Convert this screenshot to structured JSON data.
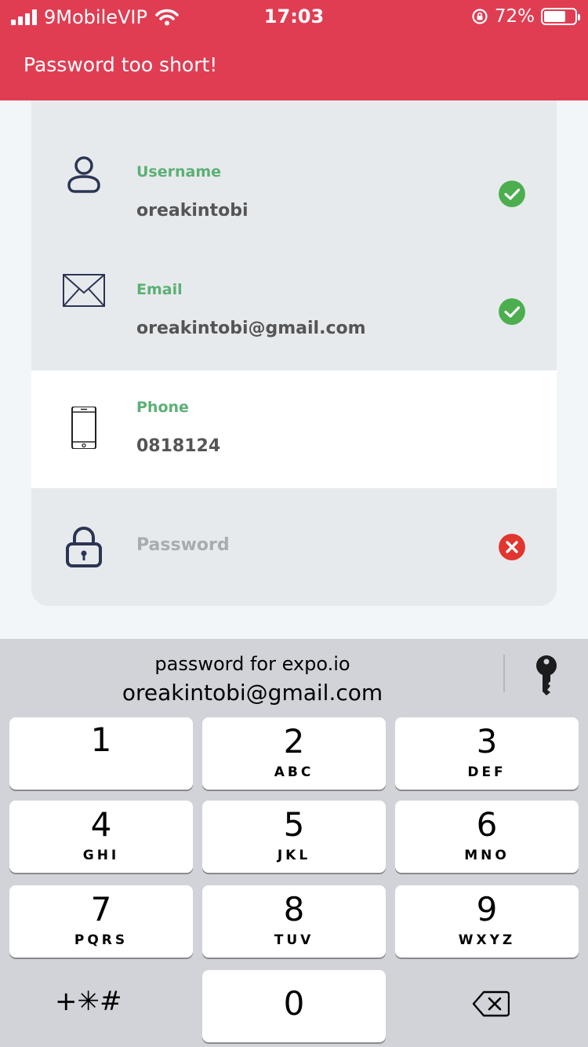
{
  "status_bar": {
    "carrier": "9MobileVIP",
    "time": "17:03",
    "battery_percent_text": "72%",
    "battery_level": 0.72
  },
  "toast": {
    "message": "Password too short!",
    "color": "#e03d53"
  },
  "form": {
    "fields": [
      {
        "label": "Username",
        "value": "oreakintobi",
        "icon": "user-icon",
        "status": "valid"
      },
      {
        "label": "Email",
        "value": "oreakintobi@gmail.com",
        "icon": "envelope-icon",
        "status": "valid"
      },
      {
        "label": "Phone",
        "value": "0818124",
        "icon": "phone-icon",
        "status": "none"
      },
      {
        "label": "",
        "placeholder": "Password",
        "icon": "lock-icon",
        "status": "invalid"
      }
    ],
    "colors": {
      "label": "#5bb075",
      "valid": "#4cae4f",
      "invalid": "#e0362f"
    }
  },
  "keyboard": {
    "suggestion_line1": "password for expo.io",
    "suggestion_line2": "oreakintobi@gmail.com",
    "keys": [
      {
        "num": "1",
        "letters": ""
      },
      {
        "num": "2",
        "letters": "ABC"
      },
      {
        "num": "3",
        "letters": "DEF"
      },
      {
        "num": "4",
        "letters": "GHI"
      },
      {
        "num": "5",
        "letters": "JKL"
      },
      {
        "num": "6",
        "letters": "MNO"
      },
      {
        "num": "7",
        "letters": "PQRS"
      },
      {
        "num": "8",
        "letters": "TUV"
      },
      {
        "num": "9",
        "letters": "WXYZ"
      },
      {
        "num": "0",
        "letters": ""
      }
    ],
    "symbols_label": "+✳#"
  }
}
